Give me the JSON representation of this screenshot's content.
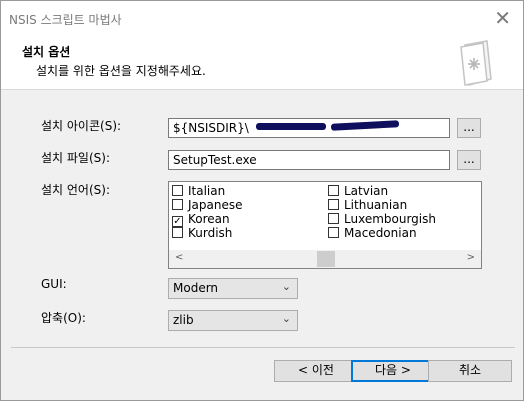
{
  "window": {
    "title": "NSIS 스크립트 마법사",
    "close_glyph": "✕"
  },
  "header": {
    "title": "설치 옵션",
    "subtitle": "설치를 위한 옵션을 지정해주세요.",
    "icon": "installer-page-icon"
  },
  "fields": {
    "icon_label": "설치 아이콘(S):",
    "icon_value": "${NSISDIR}\\",
    "file_label": "설치 파일(S):",
    "file_value": "SetupTest.exe",
    "browse_label": "...",
    "language_label": "설치 언어(S):",
    "gui_label": "GUI:",
    "gui_value": "Modern",
    "compress_label": "압축(O):",
    "compress_value": "zlib"
  },
  "languages": [
    {
      "name": "Italian",
      "checked": false
    },
    {
      "name": "Japanese",
      "checked": false
    },
    {
      "name": "Korean",
      "checked": true
    },
    {
      "name": "Kurdish",
      "checked": false
    },
    {
      "name": "Latvian",
      "checked": false
    },
    {
      "name": "Lithuanian",
      "checked": false
    },
    {
      "name": "Luxembourgish",
      "checked": false
    },
    {
      "name": "Macedonian",
      "checked": false
    }
  ],
  "scroll": {
    "left": "<",
    "right": ">"
  },
  "buttons": {
    "back": "< 이전",
    "next": "다음 >",
    "cancel": "취소"
  },
  "colors": {
    "redaction": "#0f0f5e",
    "accent": "#0078d7"
  }
}
